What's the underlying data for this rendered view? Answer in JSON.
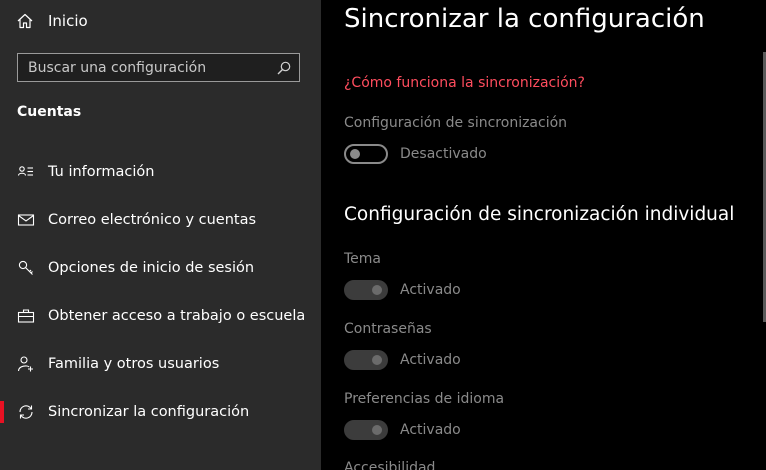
{
  "sidebar": {
    "home_label": "Inicio",
    "search_placeholder": "Buscar una configuración",
    "section_title": "Cuentas",
    "items": [
      {
        "label": "Tu información",
        "icon": "contact-card-icon"
      },
      {
        "label": "Correo electrónico y cuentas",
        "icon": "mail-icon"
      },
      {
        "label": "Opciones de inicio de sesión",
        "icon": "key-icon"
      },
      {
        "label": "Obtener acceso a trabajo o escuela",
        "icon": "briefcase-icon"
      },
      {
        "label": "Familia y otros usuarios",
        "icon": "add-person-icon"
      },
      {
        "label": "Sincronizar la configuración",
        "icon": "sync-icon",
        "active": true
      }
    ]
  },
  "main": {
    "title": "Sincronizar la configuración",
    "help_link": "¿Cómo funciona la sincronización?",
    "sync_settings": {
      "label": "Configuración de sincronización",
      "state": "Desactivado",
      "on": false
    },
    "individual_title": "Configuración de sincronización individual",
    "individual": [
      {
        "label": "Tema",
        "state": "Activado",
        "on": true
      },
      {
        "label": "Contraseñas",
        "state": "Activado",
        "on": true
      },
      {
        "label": "Preferencias de idioma",
        "state": "Activado",
        "on": true
      },
      {
        "label": "Accesibilidad"
      }
    ]
  },
  "colors": {
    "sidebar_bg": "#2b2b2b",
    "main_bg": "#000000",
    "accent": "#e81123",
    "link": "#ff4d5e",
    "muted_text": "#8a8a8a"
  }
}
